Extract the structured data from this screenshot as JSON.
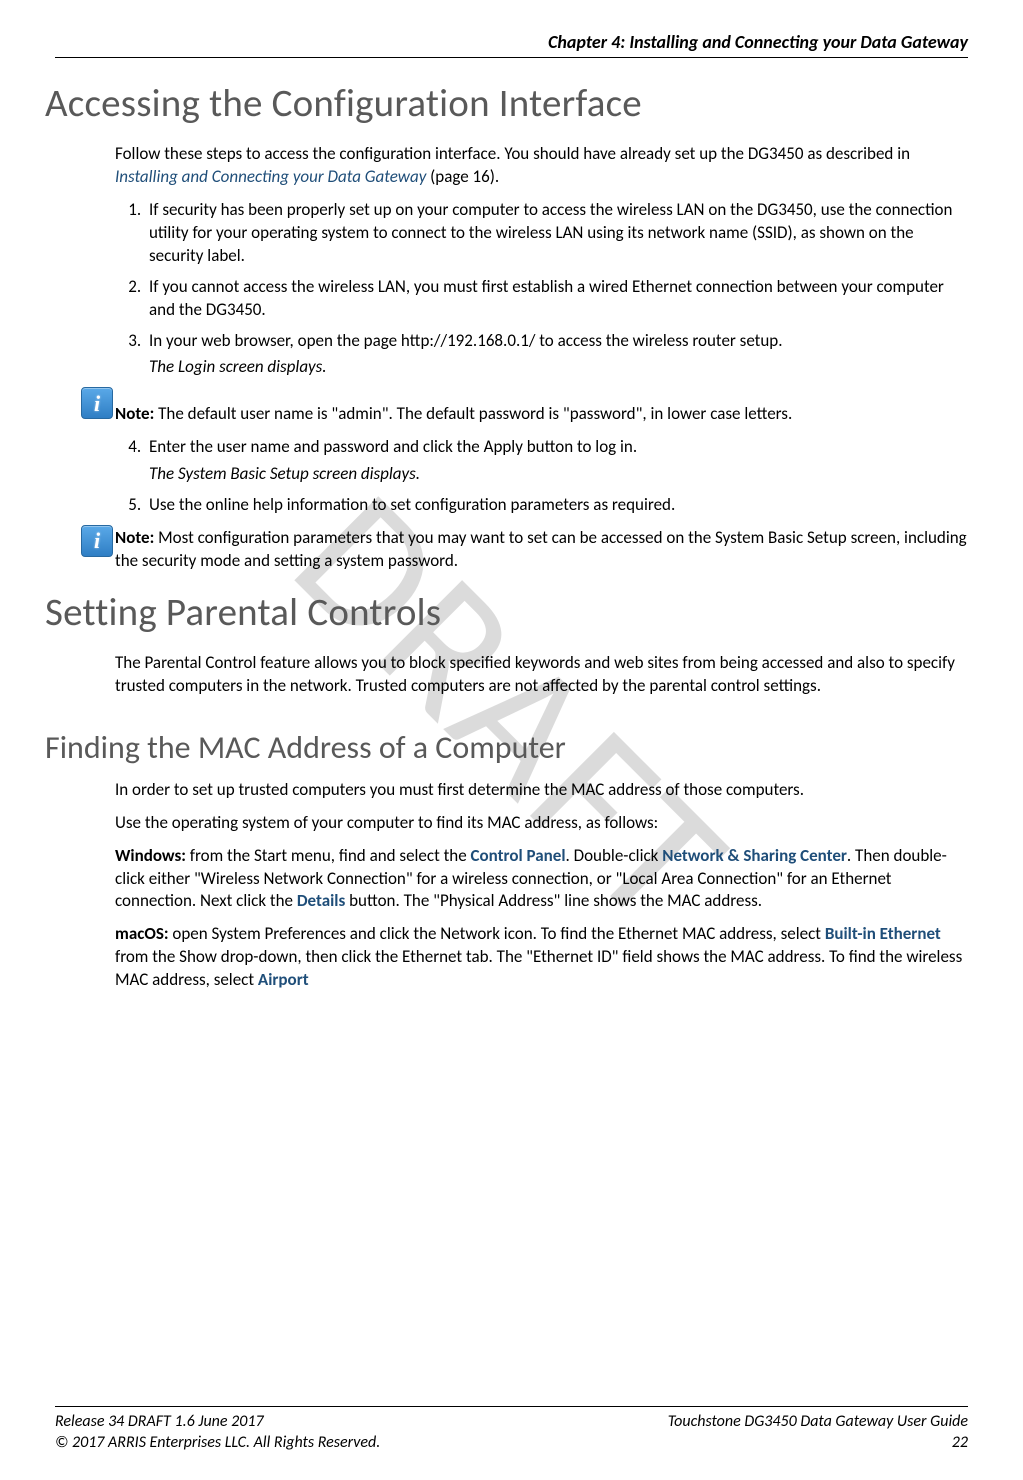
{
  "watermark": "DRAFT",
  "chapter_header": "Chapter 4: Installing and Connecting your Data Gateway",
  "section1": {
    "title": "Accessing the Configuration Interface",
    "intro_a": "Follow these steps to access the configuration interface. You should have already set up the DG3450 as described in ",
    "intro_link": "Installing and Connecting your Data Gateway",
    "intro_b": " (page 16).",
    "steps": [
      "If security has been properly set up on your computer to access the wireless LAN on the DG3450, use the connection utility for your operating system to connect to the wireless LAN using its network name (SSID), as shown on the security label.",
      "If you cannot access the wireless LAN, you must first establish a wired Ethernet connection between your computer and the DG3450.",
      "In your web browser, open the page http://192.168.0.1/ to access the wireless router setup.",
      "Enter the user name and password and click the Apply button to log in.",
      "Use the online help information to set configuration parameters as required."
    ],
    "step3_sub": "The Login screen displays.",
    "step4_sub": "The System Basic Setup screen displays.",
    "note1_label": "Note:",
    "note1_text": " The default user name is \"admin\". The default password is \"password\", in lower case letters.",
    "note2_label": "Note:",
    "note2_text": " Most configuration parameters that you may want to set can be accessed on the System Basic Setup screen, including the security mode and setting a system password."
  },
  "section2": {
    "title": "Setting Parental Controls",
    "body": "The Parental Control feature allows you to block specified keywords and web sites from being accessed and also to specify trusted computers in the network. Trusted computers are not affected by the parental control settings."
  },
  "section3": {
    "title": "Finding the MAC Address of a Computer",
    "p1": "In order to set up trusted computers you must first determine the MAC address of those computers.",
    "p2": "Use the operating system of your computer to find its MAC address, as follows:",
    "win_label": "Windows:",
    "win_a": " from the Start menu, find and select the ",
    "win_link1": "Control Panel",
    "win_b": ". Double-click ",
    "win_link2": "Network & Sharing Center",
    "win_c": ". Then double-click either \"Wireless Network Connection\" for a wireless connection, or \"Local Area Connection\" for an Ethernet connection. Next click the ",
    "win_link3": "Details",
    "win_d": " button. The \"Physical Address\" line shows the MAC address.",
    "mac_label": "macOS:",
    "mac_a": " open System Preferences and click the Network icon. To find the Ethernet MAC address, select ",
    "mac_link1": "Built-in Ethernet",
    "mac_b": " from the Show drop-down, then click the Ethernet tab. The \"Ethernet ID\" field shows the MAC address. To find the wireless MAC address, select ",
    "mac_link2": "Airport"
  },
  "footer": {
    "release": "Release 34 DRAFT 1.6    June 2017",
    "copyright": "© 2017 ARRIS Enterprises LLC. All Rights Reserved.",
    "guide": "Touchstone DG3450 Data Gateway User Guide",
    "page": "22"
  }
}
